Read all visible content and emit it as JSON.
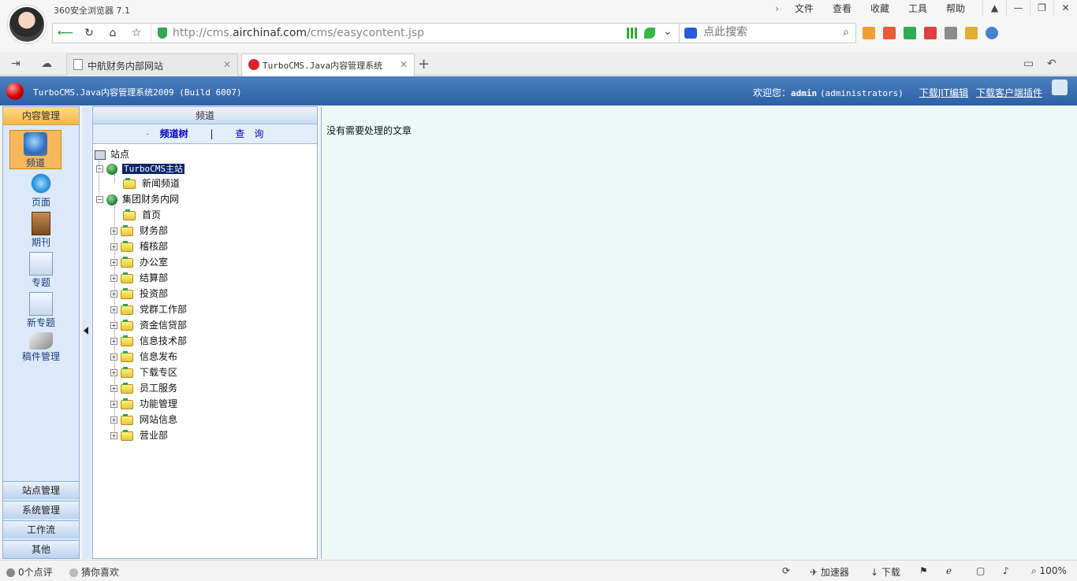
{
  "browser": {
    "title": "360安全浏览器 7.1",
    "menu": [
      "文件",
      "查看",
      "收藏",
      "工具",
      "帮助"
    ],
    "url_prefix": "http://cms.",
    "url_domain": "airchinaf.com",
    "url_path": "/cms/easycontent.jsp",
    "search_placeholder": "点此搜索",
    "tabs": [
      {
        "label": "中航财务内部网站"
      },
      {
        "label": "TurboCMS.Java内容管理系统"
      }
    ],
    "status": {
      "comments": "0个点评",
      "guess": "猜你喜欢",
      "accelerator": "加速器",
      "download": "下载",
      "zoom": "100%"
    }
  },
  "cms": {
    "title": "TurboCMS.Java内容管理系统2009 (Build 6007)",
    "welcome": "欢迎您：",
    "user": "admin",
    "role": "(administrators)",
    "link_editor": "下载JIT编辑",
    "link_plugin": "下载客户端插件",
    "leftnav": {
      "header": "内容管理",
      "items": [
        {
          "label": "频道",
          "icon": "channel-icon"
        },
        {
          "label": "页面",
          "icon": "ie-icon"
        },
        {
          "label": "期刊",
          "icon": "journal-icon"
        },
        {
          "label": "专题",
          "icon": "topic-icon"
        },
        {
          "label": "新专题",
          "icon": "new-topic-icon"
        },
        {
          "label": "稿件管理",
          "icon": "manuscript-icon"
        }
      ],
      "bottom": [
        "站点管理",
        "系统管理",
        "工作流",
        "其他"
      ]
    },
    "tree_panel": {
      "header": "频道",
      "tab_tree": "频道树",
      "tab_query": "查　询",
      "root": "站点",
      "site1": "TurboCMS主站",
      "site1_children": [
        "新闻频道"
      ],
      "site2": "集团财务内网",
      "site2_children": [
        "首页",
        "财务部",
        "稽核部",
        "办公室",
        "结算部",
        "投资部",
        "党群工作部",
        "资金信贷部",
        "信息技术部",
        "信息发布",
        "下载专区",
        "员工服务",
        "功能管理",
        "网站信息",
        "营业部"
      ]
    },
    "content_message": "没有需要处理的文章"
  }
}
